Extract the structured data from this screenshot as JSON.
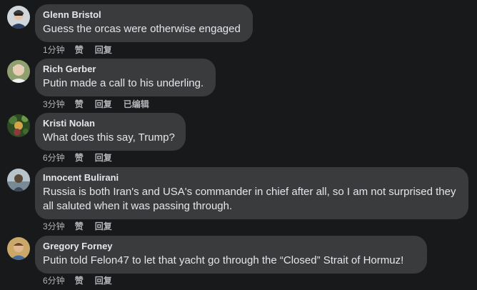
{
  "comments": [
    {
      "author": "Glenn Bristol",
      "text": "Guess the orcas were otherwise engaged",
      "time": "1分钟",
      "like": "赞",
      "reply": "回复",
      "edited": "",
      "avatar_color": "#6b7a8a"
    },
    {
      "author": "Rich Gerber",
      "text": "Putin made a call to his underling.",
      "time": "3分钟",
      "like": "赞",
      "reply": "回复",
      "edited": "已编辑",
      "avatar_color": "#7a8a5a"
    },
    {
      "author": "Kristi Nolan",
      "text": "What does this say, Trump?",
      "time": "6分钟",
      "like": "赞",
      "reply": "回复",
      "edited": "",
      "avatar_color": "#2f5a2a"
    },
    {
      "author": "Innocent Bulirani",
      "text": "Russia is both Iran's and USA's commander in chief after all, so I am not surprised they all saluted when it was passing through.",
      "time": "3分钟",
      "like": "赞",
      "reply": "回复",
      "edited": "",
      "avatar_color": "#8a9aa6"
    },
    {
      "author": "Gregory Forney",
      "text": "Putin told Felon47 to let that yacht go through the “Closed” Strait of Hormuz!",
      "time": "6分钟",
      "like": "赞",
      "reply": "回复",
      "edited": "",
      "avatar_color": "#a88a5a"
    }
  ]
}
